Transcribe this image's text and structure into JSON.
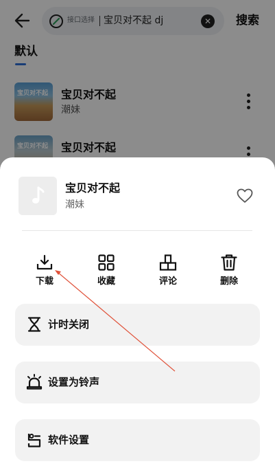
{
  "header": {
    "back_icon": "arrow-left-icon",
    "search": {
      "source_icon": "source-switch-icon",
      "source_label": "接口选择",
      "query": "宝贝对不起 dj",
      "clear_icon": "clear-icon"
    },
    "search_button": "搜索"
  },
  "tabs": [
    {
      "label": "默认",
      "active": true
    }
  ],
  "results": [
    {
      "title": "宝贝对不起",
      "artist": "潮妹",
      "cover_caption": "宝贝对不起"
    },
    {
      "title": "宝贝对不起",
      "artist": "",
      "cover_caption": "宝贝对不起"
    }
  ],
  "sheet": {
    "song_title": "宝贝对不起",
    "artist": "潮妹",
    "cover_icon": "music-note-icon",
    "favorite_icon": "heart-icon",
    "actions": [
      {
        "label": "下载",
        "icon": "download-icon"
      },
      {
        "label": "收藏",
        "icon": "collect-grid-icon"
      },
      {
        "label": "评论",
        "icon": "comment-icon"
      },
      {
        "label": "删除",
        "icon": "trash-icon"
      }
    ],
    "options": [
      {
        "label": "计时关闭",
        "icon": "hourglass-icon"
      },
      {
        "label": "设置为铃声",
        "icon": "alarm-bell-icon"
      },
      {
        "label": "软件设置",
        "icon": "settings-icon"
      }
    ]
  },
  "colors": {
    "accent": "#2f6fd8",
    "overlay": "rgba(0,0,0,0.45)",
    "annotation_arrow": "#e0523a"
  }
}
